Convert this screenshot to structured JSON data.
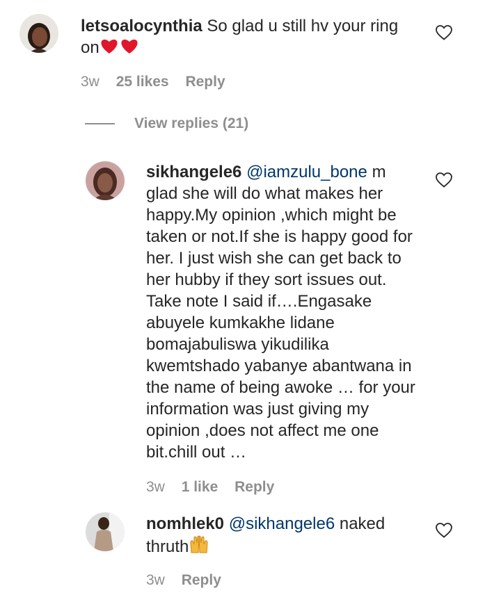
{
  "comments": [
    {
      "username": "letsoalocynthia",
      "text": "So glad u still hv your ring on",
      "emoji": "two-red-hearts",
      "time": "3w",
      "likes": "25 likes",
      "reply_label": "Reply"
    },
    {
      "username": "sikhangele6",
      "mention": "@iamzulu_bone",
      "text": "m glad she will do what makes her happy.My opinion ,which might be taken or not.If she is happy good for her. I just wish she can get back to her hubby if they sort issues out. Take note I said if….Engasake abuyele kumkakhe lidane bomajabuliswa yikudilika kwemtshado yabanye abantwana in the name of being awoke … for your information was just giving my opinion ,does not affect me one bit.chill out …",
      "time": "3w",
      "likes": "1 like",
      "reply_label": "Reply"
    },
    {
      "username": "nomhlek0",
      "mention": "@sikhangele6",
      "text": "naked thruth",
      "emoji": "raised-hands",
      "time": "3w",
      "reply_label": "Reply"
    }
  ],
  "view_replies_label": "View replies (21)",
  "icons": {
    "like": "heart-outline-icon"
  },
  "colors": {
    "text": "#262626",
    "secondary": "#8e8e8e",
    "mention": "#00376b",
    "heart_emoji": "#e0162b"
  }
}
